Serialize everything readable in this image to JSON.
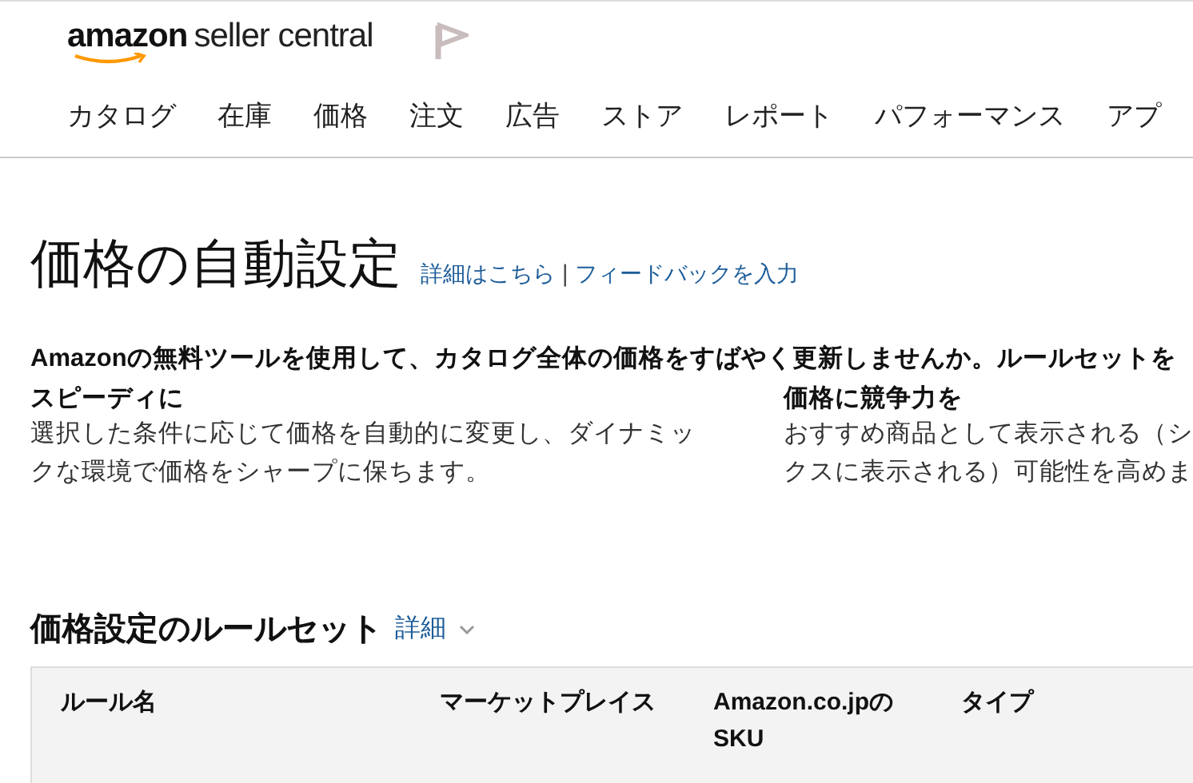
{
  "header": {
    "logo_brand": "amazon",
    "logo_product": "seller central"
  },
  "nav": [
    {
      "label": "カタログ"
    },
    {
      "label": "在庫"
    },
    {
      "label": "価格"
    },
    {
      "label": "注文"
    },
    {
      "label": "広告"
    },
    {
      "label": "ストア"
    },
    {
      "label": "レポート"
    },
    {
      "label": "パフォーマンス"
    },
    {
      "label": "アプ"
    }
  ],
  "page": {
    "title": "価格の自動設定",
    "links": [
      "詳細はこちら",
      "フィードバックを入力"
    ],
    "separator": "|"
  },
  "intro": "Amazonの無料ツールを使用して、カタログ全体の価格をすばやく更新しませんか。ルールセットを",
  "features": [
    {
      "title": "スピーディに",
      "lines": [
        "選択した条件に応じて価格を自動的に変更し、ダイナミッ",
        "クな環境で価格をシャープに保ちます。"
      ]
    },
    {
      "title": "価格に競争力を",
      "lines": [
        "おすすめ商品として表示される（シ",
        "クスに表示される）可能性を高めま"
      ]
    }
  ],
  "ruleset": {
    "title": "価格設定のルールセット",
    "details_link": "詳細",
    "columns": [
      "ルール名",
      "マーケットプレイス",
      "Amazon.co.jpのSKU",
      "タイプ"
    ]
  }
}
